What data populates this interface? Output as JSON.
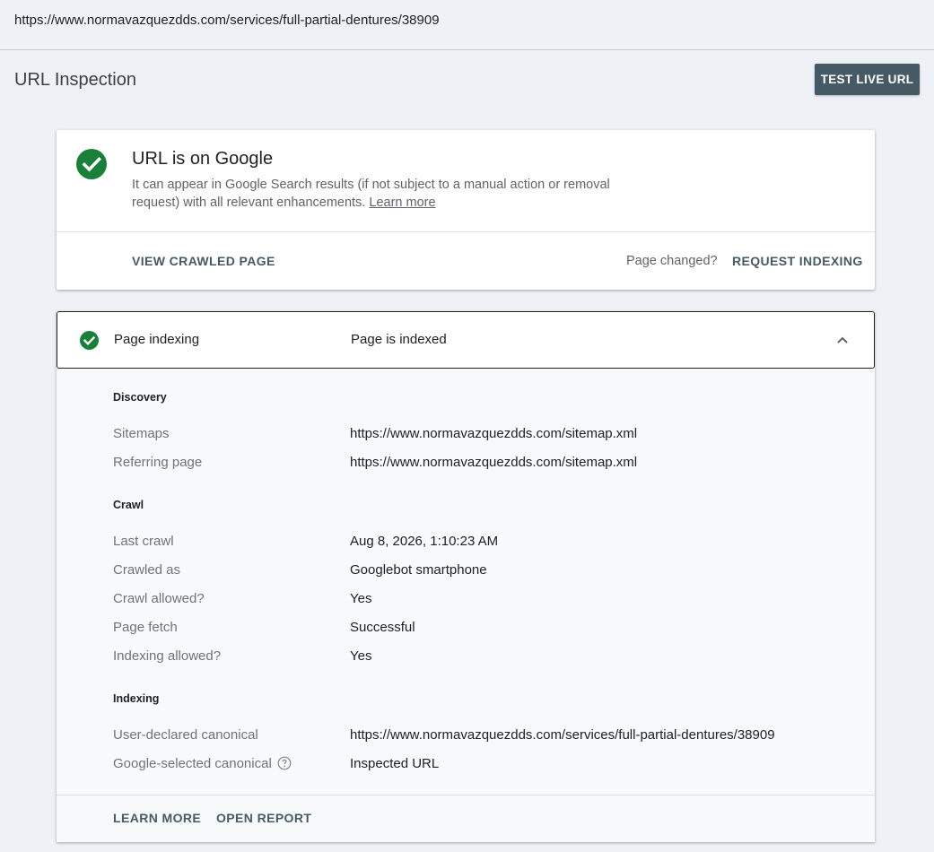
{
  "url_bar": {
    "url": "https://www.normavazquezdds.com/services/full-partial-dentures/38909"
  },
  "header": {
    "title": "URL Inspection",
    "test_live_label": "TEST LIVE URL"
  },
  "status": {
    "heading": "URL is on Google",
    "description": "It can appear in Google Search results (if not subject to a manual action or removal request) with all relevant enhancements.",
    "learn_more": "Learn more",
    "view_crawled_label": "VIEW CRAWLED PAGE",
    "page_changed": "Page changed?",
    "request_indexing_label": "REQUEST INDEXING",
    "status_color": "#188038"
  },
  "indexing": {
    "label": "Page indexing",
    "value": "Page is indexed",
    "discovery": {
      "title": "Discovery",
      "sitemaps_label": "Sitemaps",
      "sitemaps_value": "https://www.normavazquezdds.com/sitemap.xml",
      "referring_label": "Referring page",
      "referring_value": "https://www.normavazquezdds.com/sitemap.xml"
    },
    "crawl": {
      "title": "Crawl",
      "last_crawl_label": "Last crawl",
      "last_crawl_value": "Aug 8, 2026, 1:10:23 AM",
      "crawled_as_label": "Crawled as",
      "crawled_as_value": "Googlebot smartphone",
      "crawl_allowed_label": "Crawl allowed?",
      "crawl_allowed_value": "Yes",
      "page_fetch_label": "Page fetch",
      "page_fetch_value": "Successful",
      "indexing_allowed_label": "Indexing allowed?",
      "indexing_allowed_value": "Yes"
    },
    "index_section": {
      "title": "Indexing",
      "user_canonical_label": "User-declared canonical",
      "user_canonical_value": "https://www.normavazquezdds.com/services/full-partial-dentures/38909",
      "google_canonical_label": "Google-selected canonical",
      "google_canonical_value": "Inspected URL"
    },
    "learn_more_label": "LEARN MORE",
    "open_report_label": "OPEN REPORT"
  }
}
